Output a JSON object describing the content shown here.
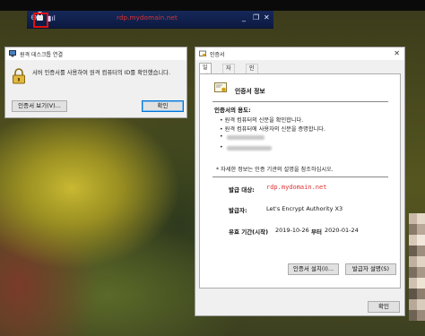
{
  "rdp_bar": {
    "host": "rdp.mydomain.net",
    "pin": "⊕",
    "signal": "▮ıl",
    "min": "_",
    "restore": "❐",
    "close": "✕"
  },
  "rdc_dialog": {
    "title": "원격 데스크톱 연결",
    "message": "서버 인증서를 사용하여 원격 컴퓨터의 ID를 확인했습니다.",
    "view_cert_button": "인증서 보기(V)...",
    "ok_button": "확인"
  },
  "cert_dialog": {
    "title": "인증서",
    "close": "✕",
    "tabs": [
      {
        "label": "일반",
        "active": true
      },
      {
        "label": "자세히",
        "active": false
      },
      {
        "label": "인증 경로",
        "active": false
      }
    ],
    "info_title": "인증서 정보",
    "purpose_title": "인증서의 용도:",
    "purposes": [
      "원격 컴퓨터의 신분을 확인합니다.",
      "원격 컴퓨터에 사용자의 신분을 증명합니다."
    ],
    "note": "* 자세한 정보는 인증 기관의 설명을 참조하십시오.",
    "issued_to_label": "발급 대상:",
    "issued_to_value": "rdp.mydomain.net",
    "issued_by_label": "발급자:",
    "issued_by_value": "Let's Encrypt Authority X3",
    "valid_label": "유효 기간(시작)",
    "valid_from": "2019-10-26",
    "valid_to_label": "부터",
    "valid_to": "2020-01-24",
    "install_button": "인증서 설치(I)...",
    "issuer_statement_button": "발급자 설명(S)",
    "ok_button": "확인"
  },
  "colors": {
    "titlebar_blue": "#0c1a40",
    "accent_red": "#e03434",
    "focus_blue": "#0078d7"
  }
}
